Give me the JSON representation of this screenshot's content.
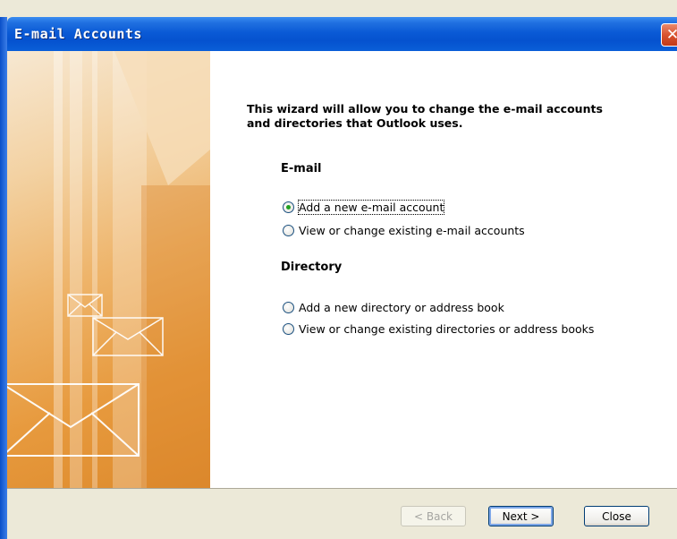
{
  "window": {
    "title": "E-mail Accounts",
    "close_glyph": "✕"
  },
  "intro": "This wizard will allow you to change the e-mail accounts and directories that Outlook uses.",
  "email_section": {
    "heading": "E-mail",
    "options": [
      {
        "label": "Add a new e-mail account",
        "selected": true
      },
      {
        "label": "View or change existing e-mail accounts",
        "selected": false
      }
    ]
  },
  "directory_section": {
    "heading": "Directory",
    "options": [
      {
        "label": "Add a new directory or address book",
        "selected": false
      },
      {
        "label": "View or change existing directories or address books",
        "selected": false
      }
    ]
  },
  "buttons": {
    "back": "< Back",
    "next": "Next >",
    "close": "Close"
  },
  "colors": {
    "titlebar": "#0a5ad6",
    "dialog_bg": "#ECE9D8",
    "art_orange": "#e79a3e"
  },
  "icons": {
    "side_art": "envelope-icon"
  }
}
